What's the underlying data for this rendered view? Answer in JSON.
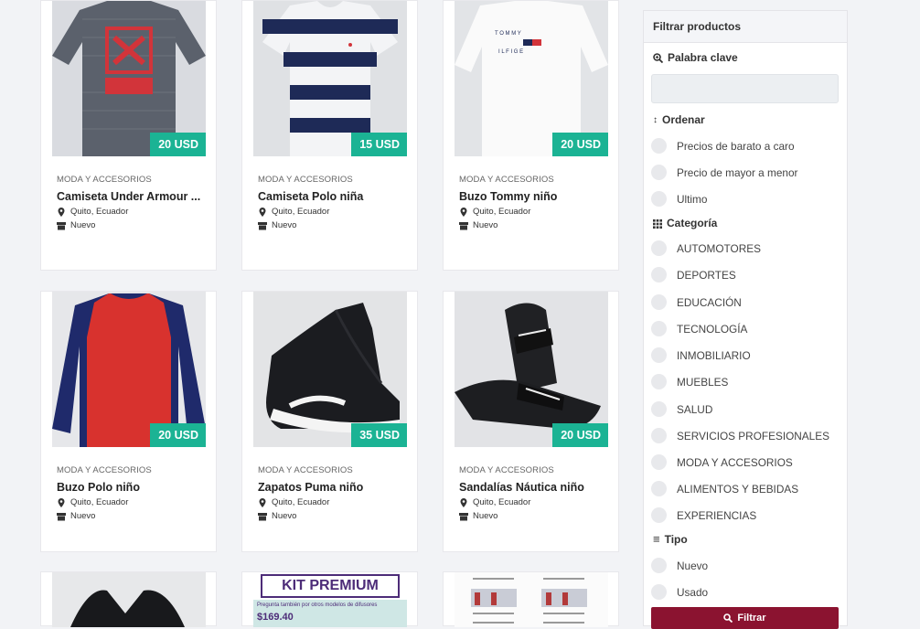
{
  "products": [
    {
      "category": "MODA Y ACCESORIOS",
      "title": "Camiseta Under Armour ...",
      "location": "Quito, Ecuador",
      "condition": "Nuevo",
      "price": "20 USD",
      "image": "gray-red-longsleeve"
    },
    {
      "category": "MODA Y ACCESORIOS",
      "title": "Camiseta Polo niña",
      "location": "Quito, Ecuador",
      "condition": "Nuevo",
      "price": "15 USD",
      "image": "navy-white-stripe-tee"
    },
    {
      "category": "MODA Y ACCESORIOS",
      "title": "Buzo Tommy niño",
      "location": "Quito, Ecuador",
      "condition": "Nuevo",
      "price": "20 USD",
      "image": "white-sweater"
    },
    {
      "category": "MODA Y ACCESORIOS",
      "title": "Buzo Polo niño",
      "location": "Quito, Ecuador",
      "condition": "Nuevo",
      "price": "20 USD",
      "image": "red-navy-raglan"
    },
    {
      "category": "MODA Y ACCESORIOS",
      "title": "Zapatos Puma niño",
      "location": "Quito, Ecuador",
      "condition": "Nuevo",
      "price": "35 USD",
      "image": "black-sneakers"
    },
    {
      "category": "MODA Y ACCESORIOS",
      "title": "Sandalías Náutica niño",
      "location": "Quito, Ecuador",
      "condition": "Nuevo",
      "price": "20 USD",
      "image": "black-slides"
    }
  ],
  "partial_cards": [
    {
      "image": "black-item"
    },
    {
      "image": "kit-premium-flyer",
      "heading": "KIT PREMIUM",
      "subtext": "Pregunta también por otros modelos de difusores",
      "price_text": "$169.40"
    },
    {
      "image": "diffuser-flyer"
    }
  ],
  "filter": {
    "header": "Filtrar productos",
    "keyword_label": "Palabra clave",
    "keyword_value": "",
    "sort_label": "Ordenar",
    "sort_options": [
      "Precios de barato a caro",
      "Precio de mayor a menor",
      "Ultimo"
    ],
    "category_label": "Categoría",
    "categories": [
      "AUTOMOTORES",
      "DEPORTES",
      "EDUCACIÓN",
      "TECNOLOGÍA",
      "INMOBILIARIO",
      "MUEBLES",
      "SALUD",
      "SERVICIOS PROFESIONALES",
      "MODA Y ACCESORIOS",
      "ALIMENTOS Y BEBIDAS",
      "EXPERIENCIAS"
    ],
    "type_label": "Tipo",
    "types": [
      "Nuevo",
      "Usado"
    ],
    "button": "Filtrar"
  },
  "colors": {
    "price_badge": "#1bb394",
    "filter_button": "#8b1330"
  }
}
